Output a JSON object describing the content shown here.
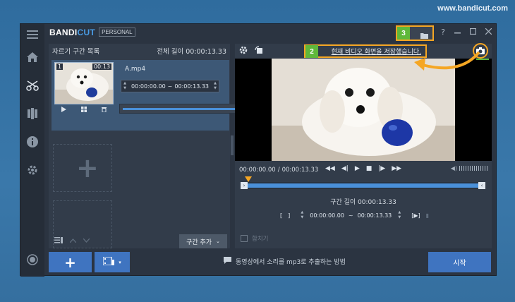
{
  "site": {
    "watermark": "www.bandicut.com"
  },
  "app": {
    "logo_main": "BANDI",
    "logo_accent": "CUT",
    "edition": "PERSONAL",
    "help": "?",
    "step3": "3",
    "step2": "2",
    "step1": "1"
  },
  "clips": {
    "title": "자르기 구간 목록",
    "total_label": "전체 길이",
    "total_time": "00:00:13.33",
    "item": {
      "index": "1",
      "duration": "00:13",
      "filename": "A.mp4",
      "start": "00:00:00.00",
      "sep": "~",
      "end": "00:00:13.33"
    },
    "add_segment": "구간 추가"
  },
  "preview": {
    "saved_message": "현재 비디오 화면을 저장했습니다.",
    "current_time": "00:00:00.00",
    "total_time": "00:00:13.33",
    "time_sep": "/",
    "segment_length_label": "구간 길이",
    "segment_length": "00:00:13.33",
    "seg_start": "00:00:00.00",
    "seg_sep": "~",
    "seg_end": "00:00:13.33",
    "merge_label": "합치기"
  },
  "bottom": {
    "howto": "동영상에서 소리를 mp3로 추출하는 방법",
    "start": "시작"
  },
  "colors": {
    "accent": "#3f74c0",
    "highlight": "#f5a623",
    "step_badge": "#5fb83a"
  }
}
